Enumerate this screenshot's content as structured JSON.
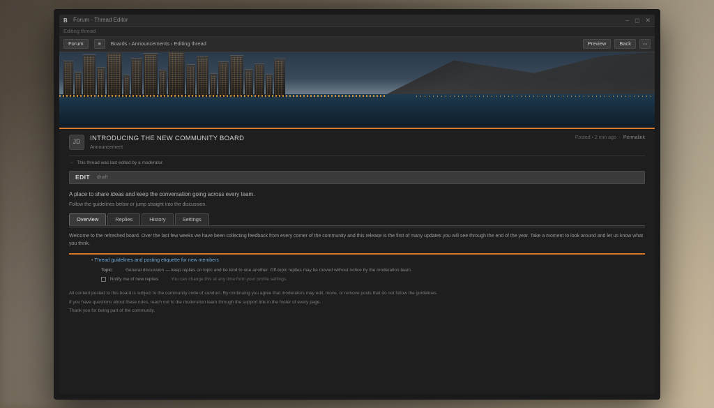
{
  "window": {
    "app_badge": "B",
    "title": "Forum · Thread Editor",
    "tab_label": "Editing thread",
    "controls": {
      "min": "–",
      "max": "◻",
      "close": "✕"
    }
  },
  "toolbar": {
    "home_label": "Forum",
    "breadcrumb": "Boards › Announcements › Editing thread",
    "btn_preview": "Preview",
    "btn_back": "Back",
    "btn_more": "⋯"
  },
  "hero": {
    "alt": "City skyline at dusk over water"
  },
  "post": {
    "avatar_initials": "JD",
    "title": "INTRODUCING THE NEW COMMUNITY BOARD",
    "subtitle": "Announcement",
    "meta_text": "Posted • 2 min ago",
    "meta_link": "Permalink"
  },
  "notice": "This thread was last edited by a moderator.",
  "editbar": {
    "label": "EDIT",
    "hint": "draft"
  },
  "lead": "A place to share ideas and keep the conversation going across every team.",
  "lead2": "Follow the guidelines below or jump straight into the discussion.",
  "tabs": [
    {
      "label": "Overview",
      "active": true
    },
    {
      "label": "Replies",
      "active": false
    },
    {
      "label": "History",
      "active": false
    },
    {
      "label": "Settings",
      "active": false
    }
  ],
  "para": "Welcome to the refreshed board. Over the last few weeks we have been collecting feedback from every corner of the community and this release is the first of many updates you will see through the end of the year. Take a moment to look around and let us know what you think.",
  "body": {
    "line1_link": "Thread guidelines and posting etiquette for new members",
    "line2_label": "Topic:",
    "line2_rest": "General discussion — keep replies on topic and be kind to one another. Off-topic replies may be moved without notice by the moderation team.",
    "line3_cb_label": "Notify me of new replies",
    "line3_note": "You can change this at any time from your profile settings."
  },
  "footer": {
    "p1": "All content posted to this board is subject to the community code of conduct. By continuing you agree that moderators may edit, move, or remove posts that do not follow the guidelines.",
    "p2": "If you have questions about these rules, reach out to the moderation team through the support link in the footer of every page.",
    "p3": "Thank you for being part of the community."
  }
}
